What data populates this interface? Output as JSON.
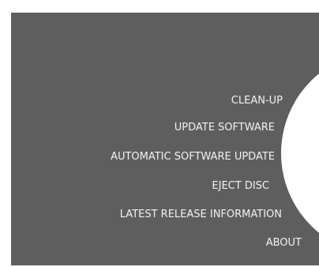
{
  "menu": {
    "items": [
      {
        "label": "CLEAN-UP"
      },
      {
        "label": "UPDATE SOFTWARE"
      },
      {
        "label": "AUTOMATIC SOFTWARE UPDATE"
      },
      {
        "label": "EJECT DISC"
      },
      {
        "label": "LATEST RELEASE INFORMATION"
      },
      {
        "label": "ABOUT"
      }
    ]
  },
  "colors": {
    "panel_background": "#5e5e5e",
    "wheel": "#ffffff",
    "text": "#f2f2f2"
  }
}
